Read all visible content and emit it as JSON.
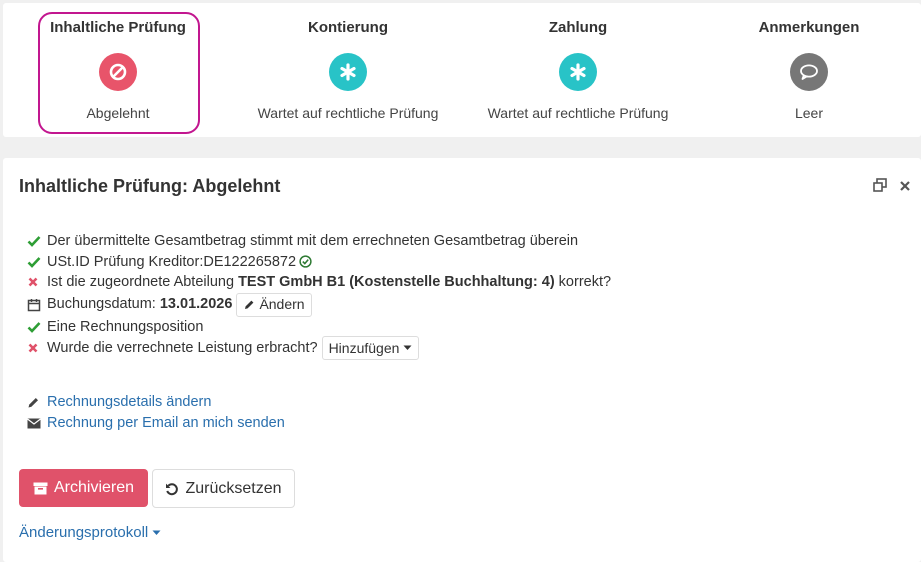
{
  "steps": [
    {
      "title": "Inhaltliche Prüfung",
      "status": "Abgelehnt",
      "icon": "ban-icon",
      "color": "#e8546a",
      "active": true
    },
    {
      "title": "Kontierung",
      "status": "Wartet auf rechtliche Prüfung",
      "icon": "asterisk-icon",
      "color": "#28c3c7",
      "active": false
    },
    {
      "title": "Zahlung",
      "status": "Wartet auf rechtliche Prüfung",
      "icon": "asterisk-icon",
      "color": "#28c3c7",
      "active": false
    },
    {
      "title": "Anmerkungen",
      "status": "Leer",
      "icon": "comment-icon",
      "color": "#777777",
      "active": false
    }
  ],
  "panel": {
    "title": "Inhaltliche Prüfung: Abgelehnt",
    "checks": {
      "total": "Der übermittelte Gesamtbetrag stimmt mit dem errechneten Gesamtbetrag überein",
      "ust_prefix": "USt.ID Prüfung Kreditor: ",
      "ust_value": "DE122265872",
      "dept_prefix": "Ist die zugeordnete Abteilung ",
      "dept_name": "TEST GmbH B1",
      "dept_cost": "(Kostenstelle Buchhaltung: 4)",
      "dept_suffix": " korrekt?",
      "date_prefix": "Buchungsdatum: ",
      "date_value": "13.01.2026",
      "date_button": "Ändern",
      "position": "Eine Rechnungsposition",
      "service": "Wurde die verrechnete Leistung erbracht?",
      "service_button": "Hinzufügen"
    },
    "links": {
      "edit_details": "Rechnungsdetails ändern",
      "send_email": "Rechnung per Email an mich senden"
    },
    "buttons": {
      "archive": "Archivieren",
      "reset": "Zurücksetzen"
    },
    "changelog": "Änderungsprotokoll"
  },
  "colors": {
    "accent": "#c2168f",
    "ok": "#2e9e35",
    "error": "#e0526a",
    "link": "#2a6fad"
  }
}
